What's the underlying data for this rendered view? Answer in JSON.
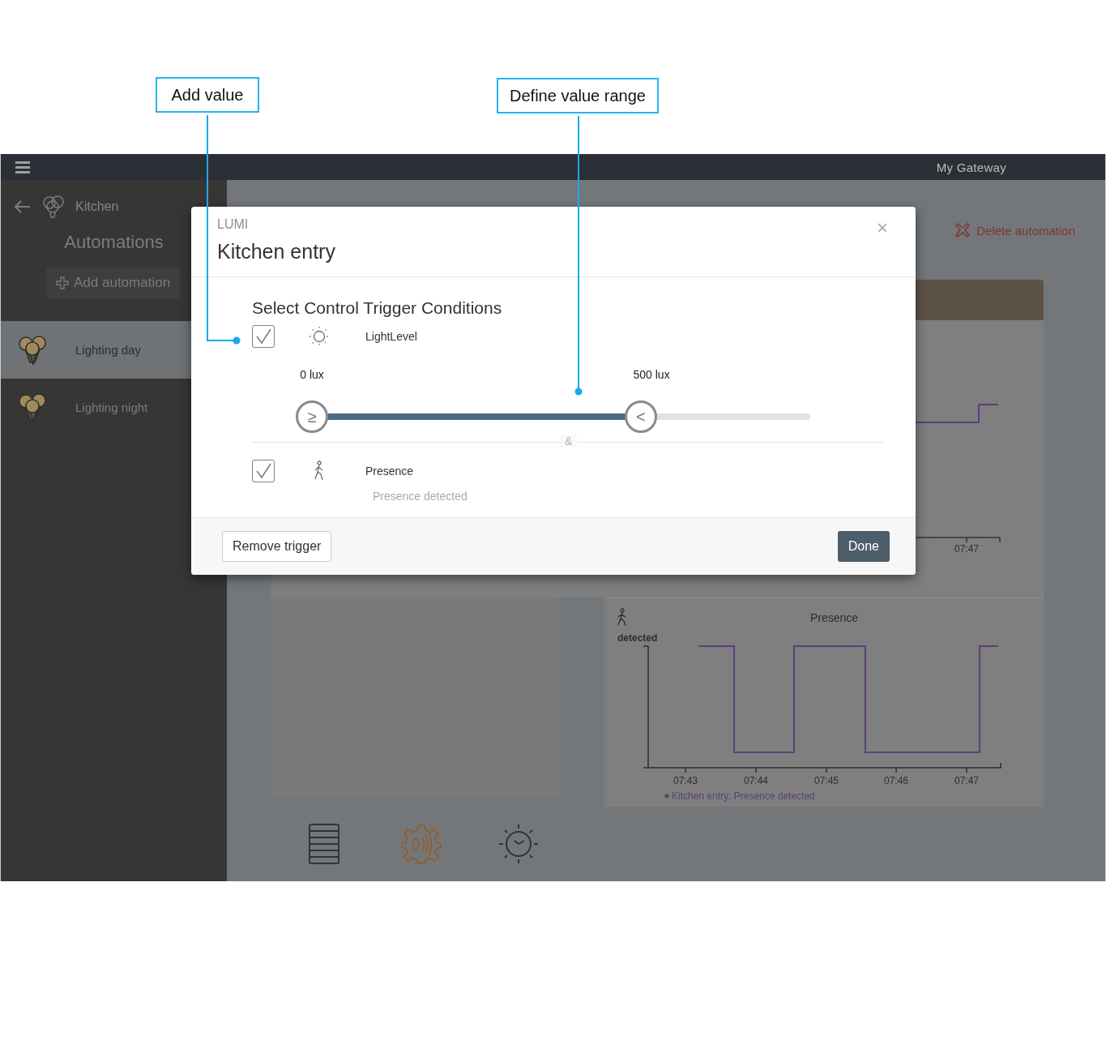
{
  "annotations": [
    {
      "label": "Add value"
    },
    {
      "label": "Define value range"
    }
  ],
  "header": {
    "gateway": "My Gateway"
  },
  "sidebar": {
    "room": "Kitchen",
    "title": "Automations",
    "add_button": "Add automation",
    "items": [
      {
        "label": "Lighting day",
        "selected": true
      },
      {
        "label": "Lighting night",
        "selected": false
      }
    ]
  },
  "main": {
    "delete_button": "Delete automation",
    "light_chart": {
      "xtick": "07:47"
    },
    "presence_chart": {
      "title": "Presence",
      "ylabel": "detected",
      "xticks": [
        "07:43",
        "07:44",
        "07:45",
        "07:46",
        "07:47"
      ],
      "legend": "Kitchen entry: Presence detected"
    },
    "bottom_tabs": [
      {
        "selected": false
      },
      {
        "selected": true
      },
      {
        "selected": false
      }
    ]
  },
  "modal": {
    "brand": "LUMI",
    "title": "Kitchen entry",
    "close": "×",
    "heading": "Select Control Trigger Conditions",
    "separator": "&",
    "conditions": [
      {
        "kind": "range",
        "checked": true,
        "label": "LightLevel",
        "min_label": "0 lux",
        "max_label": "500 lux",
        "thumbs": [
          {
            "symbol": "≥",
            "level": 0
          },
          {
            "symbol": "<",
            "level": 0.66
          }
        ]
      },
      {
        "kind": "state",
        "checked": true,
        "label": "Presence",
        "state": "Presence detected"
      }
    ],
    "remove_button": "Remove trigger",
    "done_button": "Done"
  }
}
